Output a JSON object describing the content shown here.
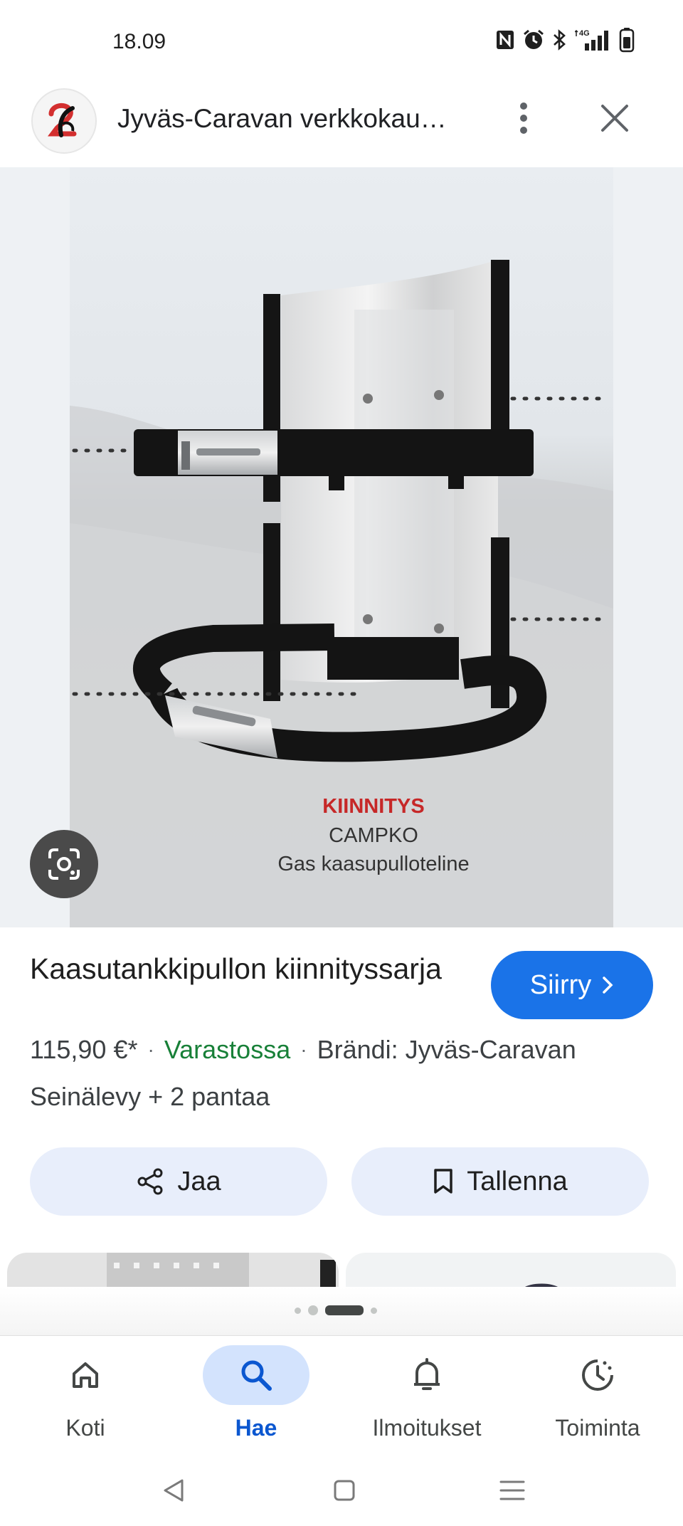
{
  "status_bar": {
    "time": "18.09",
    "icons": [
      "nfc-icon",
      "alarm-icon",
      "bluetooth-icon",
      "signal-4g-icon",
      "battery-icon"
    ],
    "network": "4G"
  },
  "header": {
    "site_title": "Jyväs-Caravan verkkokau…",
    "logo_icon": "jyvas-caravan-logo-icon",
    "more_icon": "more-vert-icon",
    "close_icon": "close-icon"
  },
  "product_image": {
    "label_line1": "KIINNITYS",
    "label_line2": "CAMPKO",
    "label_line3": "Gas kaasupulloteline",
    "lens_icon": "google-lens-icon"
  },
  "product": {
    "title": "Kaasutankkipullon kiinnityssarja",
    "visit_label": "Siirry",
    "price": "115,90 €*",
    "separator": "·",
    "stock": "Varastossa",
    "brand": "Brändi: Jyväs-Caravan",
    "description": "Seinälevy + 2 pantaa",
    "share_label": "Jaa",
    "save_label": "Tallenna"
  },
  "bottom_nav": {
    "items": [
      {
        "label": "Koti",
        "icon": "home-icon"
      },
      {
        "label": "Hae",
        "icon": "search-icon"
      },
      {
        "label": "Ilmoitukset",
        "icon": "bell-icon"
      },
      {
        "label": "Toiminta",
        "icon": "activity-icon"
      }
    ],
    "active": "Hae"
  },
  "colors": {
    "accent": "#1a73e8",
    "stock_green": "#188038",
    "nav_active": "#0b57d0",
    "pill_bg": "#e8eefb",
    "label_red": "#c62828"
  }
}
